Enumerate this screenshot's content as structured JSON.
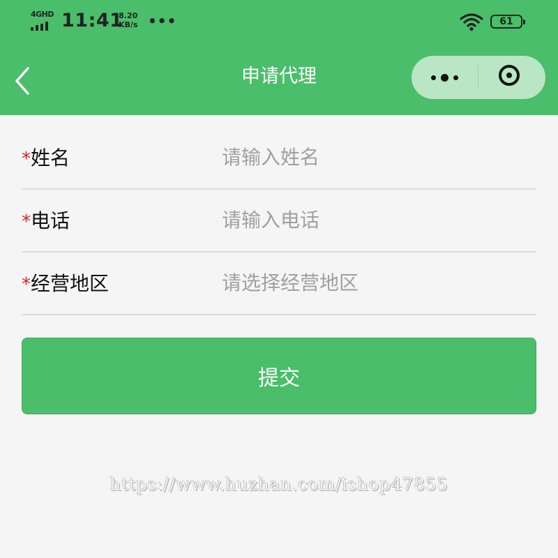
{
  "status_bar": {
    "network": "4GHD",
    "time": "11:41",
    "speed_value": "8.20",
    "speed_unit": "KB/s",
    "more_dots": "•••",
    "battery": "61"
  },
  "nav": {
    "title": "申请代理"
  },
  "form": {
    "required_mark": "*",
    "name": {
      "label": "姓名",
      "placeholder": "请输入姓名"
    },
    "phone": {
      "label": "电话",
      "placeholder": "请输入电话"
    },
    "region": {
      "label": "经营地区",
      "placeholder": "请选择经营地区"
    }
  },
  "submit_label": "提交",
  "watermark": "https://www.huzhan.com/ishop47855",
  "colors": {
    "brand_green": "#4abe6a",
    "required_red": "#e02020",
    "background": "#f5f5f5"
  }
}
